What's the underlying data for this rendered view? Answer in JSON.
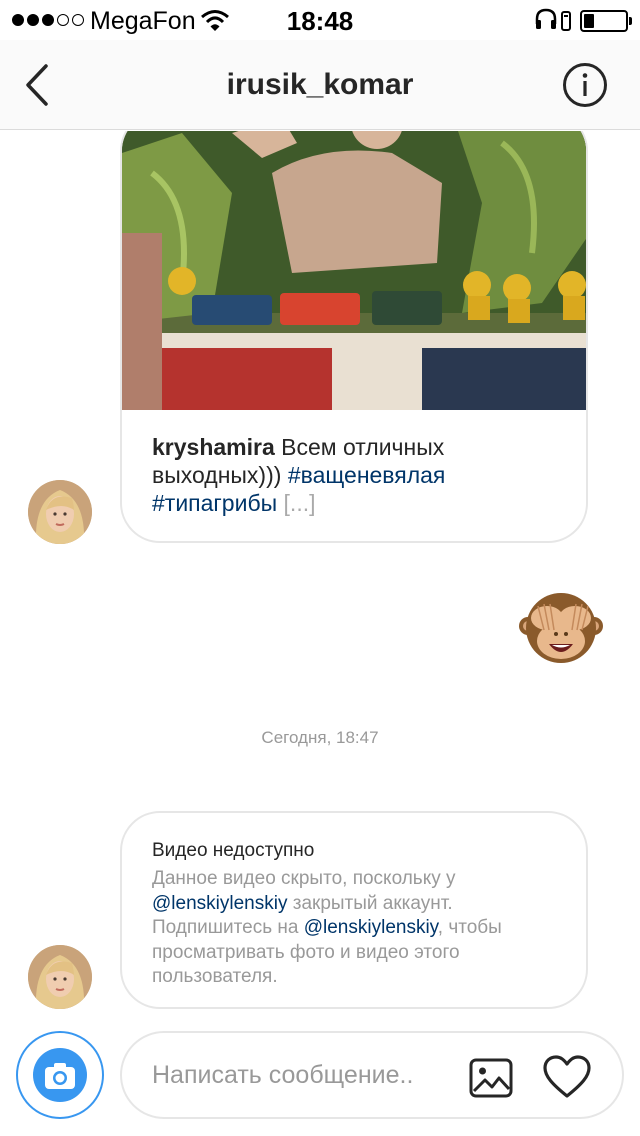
{
  "status_bar": {
    "carrier": "MegaFon",
    "time": "18:48",
    "signal_bars": 3,
    "signal_total": 5,
    "battery_level": 0.25
  },
  "nav": {
    "title": "irusik_komar",
    "back_icon": "chevron-left-icon",
    "info_icon": "info-icon"
  },
  "messages": {
    "shared_post": {
      "username": "kryshamira",
      "text": "Всем отличных выходных)))",
      "tags": [
        "#ващеневялая",
        "#типагрибы"
      ],
      "more": "[...]"
    },
    "reaction_emoji": "see-no-evil-monkey",
    "timestamp": "Сегодня, 18:47",
    "video_unavailable": {
      "title": "Видео недоступно",
      "body_1": "Данное видео скрыто, поскольку у",
      "mention_1": "@lenskiylenskiy",
      "body_2": "закрытый аккаунт. Подпишитесь на",
      "mention_2": "@lenskiylenskiy",
      "body_3": ", чтобы просматривать фото и видео этого пользователя."
    }
  },
  "composer": {
    "placeholder": "Написать сообщение...",
    "camera_icon": "camera-icon",
    "gallery_icon": "gallery-icon",
    "heart_icon": "heart-icon"
  },
  "colors": {
    "accent_blue": "#3897f0",
    "link_blue": "#003569",
    "muted_gray": "#999999",
    "bubble_border": "#e6e6e6"
  }
}
